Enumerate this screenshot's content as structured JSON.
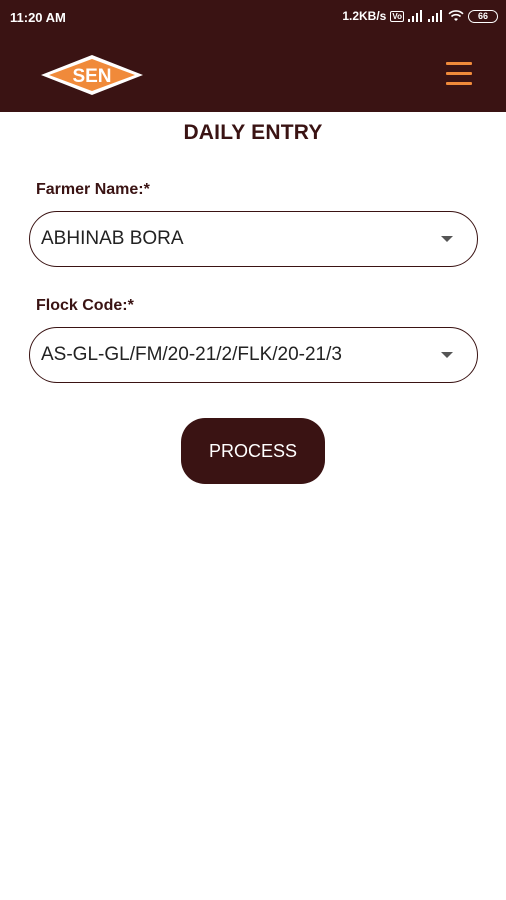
{
  "status_bar": {
    "time": "11:20 AM",
    "speed": "1.2KB/s",
    "vo_badge": "Vo",
    "battery": "66"
  },
  "header": {
    "logo_text": "SEN",
    "menu_icon": "hamburger-menu-icon"
  },
  "page": {
    "title": "DAILY ENTRY"
  },
  "form": {
    "farmer_label": "Farmer Name:*",
    "farmer_value": "ABHINAB BORA",
    "flock_label": "Flock Code:*",
    "flock_value": "AS-GL-GL/FM/20-21/2/FLK/20-21/3"
  },
  "actions": {
    "process_label": "PROCESS"
  },
  "colors": {
    "primary": "#3a1313",
    "accent": "#f08a3a"
  }
}
